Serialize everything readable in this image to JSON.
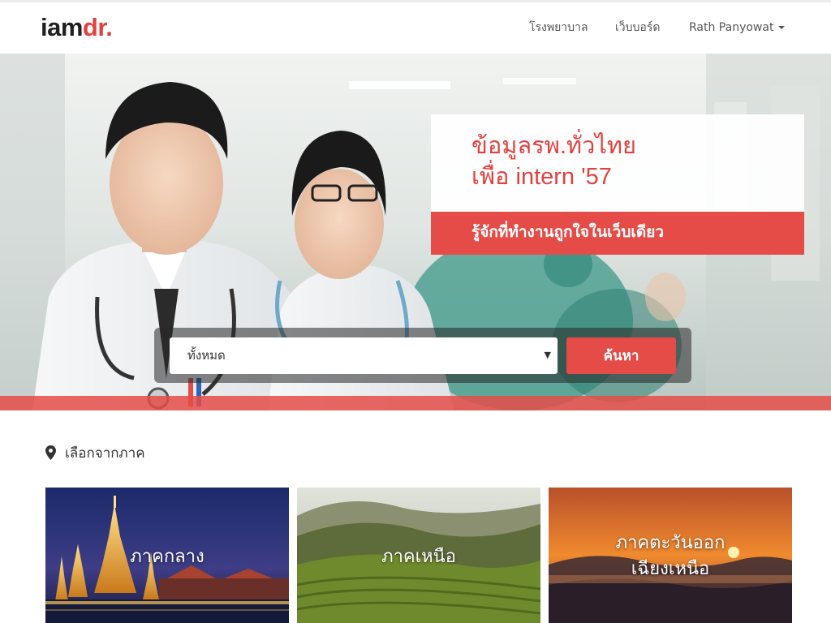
{
  "brand": {
    "logo_part1": "iam",
    "logo_part2": "dr.",
    "accent_color": "#e3413e"
  },
  "nav": {
    "hospital_label": "โรงพยาบาล",
    "board_label": "เว็บบอร์ด",
    "user_label": "Rath Panyowat"
  },
  "hero": {
    "headline_line1": "ข้อมูลรพ.ทั่วไทย",
    "headline_line2": "เพื่อ intern '57",
    "subheadline": "รู้จักที่ทำงานถูกใจในเว็บเดียว"
  },
  "search": {
    "selected_option": "ทั้งหมด",
    "button_label": "ค้นหา"
  },
  "regions": {
    "heading": "เลือกจากภาค",
    "icon": "map-marker",
    "cards": [
      {
        "label": "ภาคกลาง"
      },
      {
        "label": "ภาคเหนือ"
      },
      {
        "label_line1": "ภาคตะวันออก",
        "label_line2": "เฉียงเหนือ"
      }
    ]
  }
}
